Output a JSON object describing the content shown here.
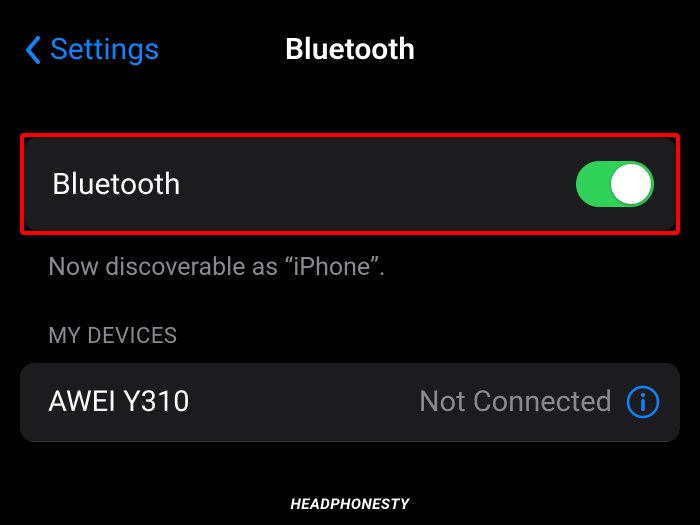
{
  "header": {
    "back_label": "Settings",
    "title": "Bluetooth"
  },
  "bluetooth": {
    "label": "Bluetooth",
    "enabled": true,
    "discoverable_text": "Now discoverable as “iPhone”."
  },
  "devices": {
    "section_header": "MY DEVICES",
    "list": [
      {
        "name": "AWEI Y310",
        "status": "Not Connected"
      }
    ]
  },
  "watermark": "HEADPHONESTY"
}
